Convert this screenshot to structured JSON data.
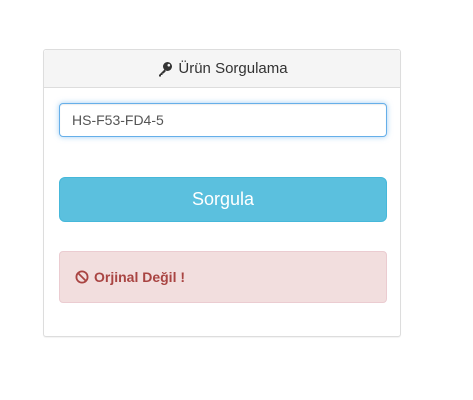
{
  "panel": {
    "title": "Ürün Sorgulama",
    "title_icon": "key-icon"
  },
  "form": {
    "code_value": "HS-F53-FD4-5",
    "submit_label": "Sorgula"
  },
  "result": {
    "icon": "ban-icon",
    "message": "Orjinal Değil !"
  },
  "colors": {
    "button": "#5bc0de",
    "alert_bg": "#f2dede",
    "alert_text": "#a94442",
    "focus_border": "#66afe9"
  }
}
